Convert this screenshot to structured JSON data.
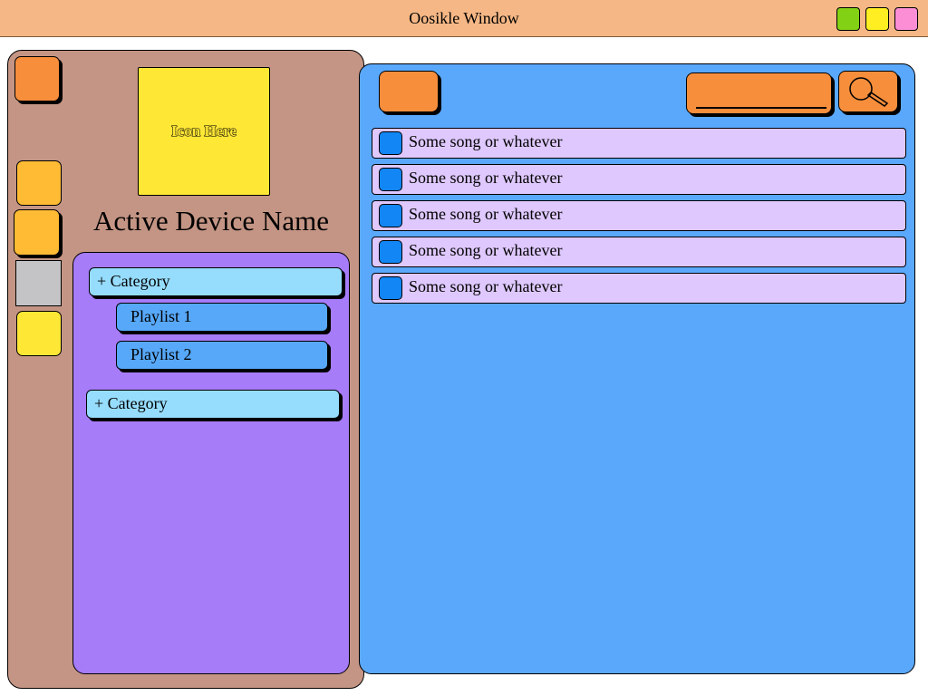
{
  "window": {
    "title": "Oosikle Window",
    "controls": [
      {
        "name": "green",
        "color": "#83d114"
      },
      {
        "name": "yellow",
        "color": "#ffee22"
      },
      {
        "name": "pink",
        "color": "#fc8ed5"
      }
    ]
  },
  "sidebar": {
    "icon_placeholder": "Icon Here",
    "device_name": "Active Device Name",
    "categories": [
      {
        "label": "+ Category",
        "playlists": [
          "Playlist 1",
          "Playlist 2"
        ]
      },
      {
        "label": "+ Category",
        "playlists": []
      }
    ],
    "tool_colors": [
      "#f78e3c",
      "#ffbb34",
      "#ffbb34",
      "#c4c4c6",
      "#ffe736"
    ]
  },
  "main": {
    "search": {
      "icon": "magnifier-icon"
    },
    "songs": [
      "Some song or whatever",
      "Some song or whatever",
      "Some song or whatever",
      "Some song or whatever",
      "Some song or whatever"
    ]
  }
}
